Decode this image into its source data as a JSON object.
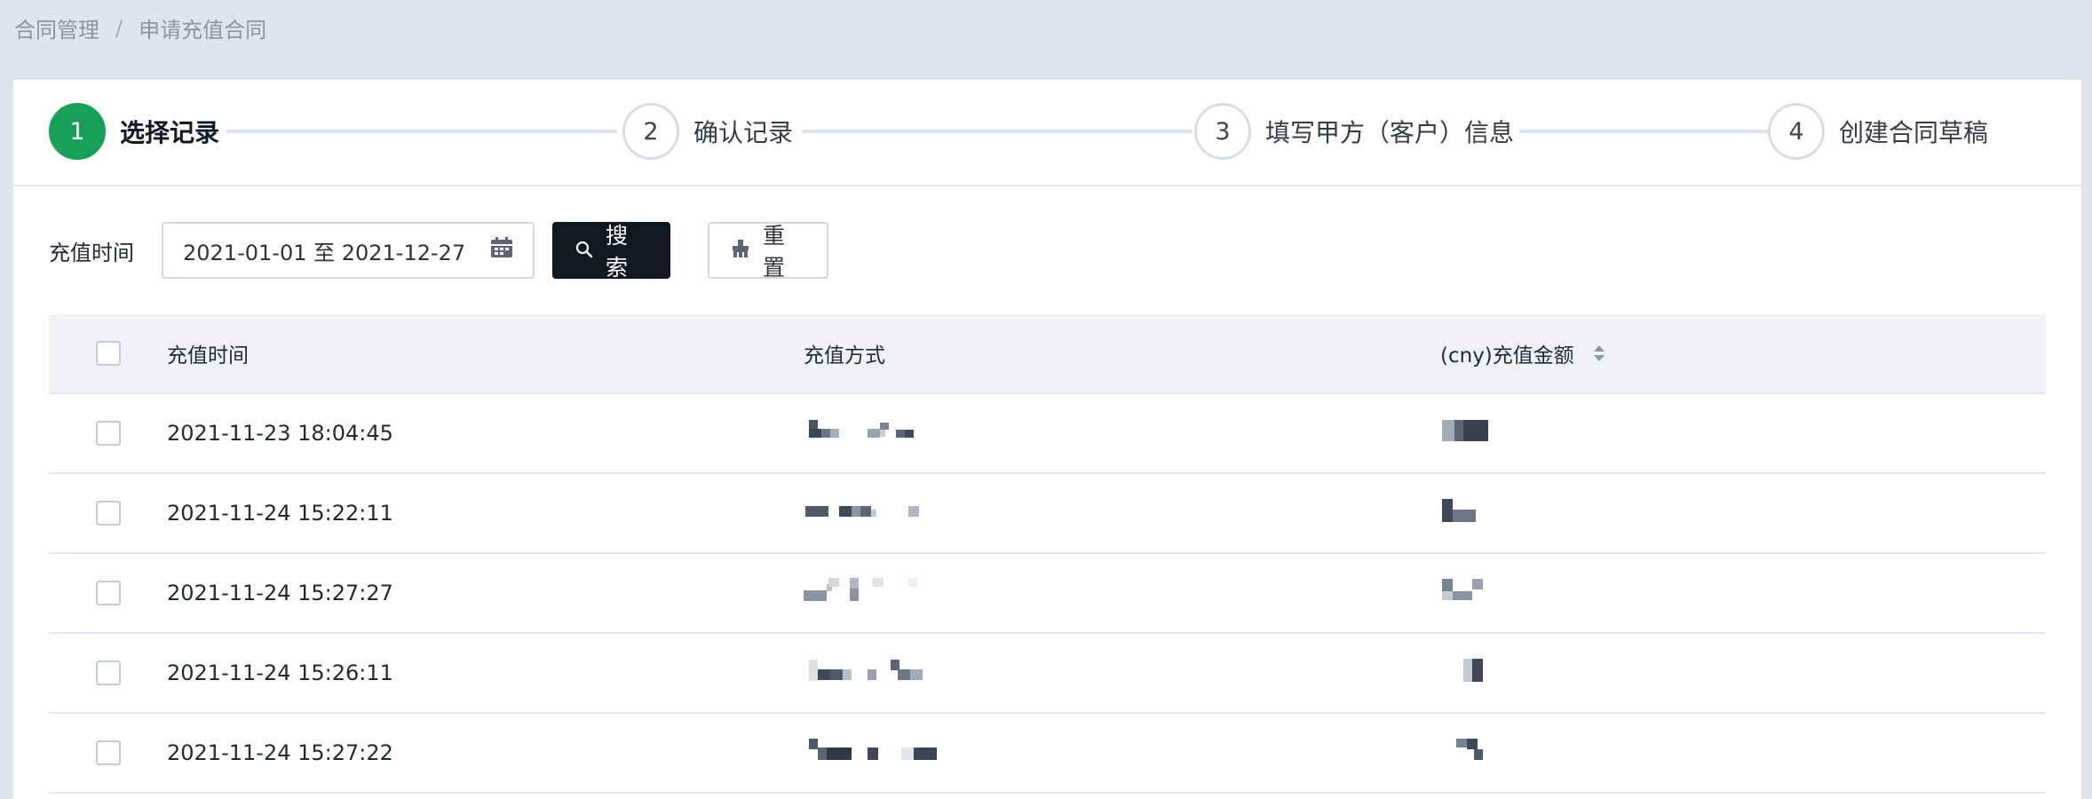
{
  "breadcrumb": {
    "root": "合同管理",
    "separator": "/",
    "current": "申请充值合同"
  },
  "steps": [
    {
      "number": "1",
      "label": "选择记录",
      "active": true
    },
    {
      "number": "2",
      "label": "确认记录",
      "active": false
    },
    {
      "number": "3",
      "label": "填写甲方（客户）信息",
      "active": false
    },
    {
      "number": "4",
      "label": "创建合同草稿",
      "active": false
    }
  ],
  "filter": {
    "label": "充值时间",
    "date_range": "2021-01-01 至 2021-12-27",
    "search_label": "搜索",
    "reset_label": "重置"
  },
  "table": {
    "columns": [
      "充值时间",
      "充值方式",
      "(cny)充值金额"
    ],
    "rows": [
      {
        "time": "2021-11-23 18:04:45",
        "method": "[pixelated]",
        "amount": "[pixelated]"
      },
      {
        "time": "2021-11-24 15:22:11",
        "method": "[pixelated]",
        "amount": "[pixelated]"
      },
      {
        "time": "2021-11-24 15:27:27",
        "method": "[pixelated]",
        "amount": "[pixelated]"
      },
      {
        "time": "2021-11-24 15:26:11",
        "method": "[pixelated]",
        "amount": "[pixelated]"
      },
      {
        "time": "2021-11-24 15:27:22",
        "method": "[pixelated]",
        "amount": "[pixelated]"
      }
    ]
  },
  "icons": {
    "calendar": "calendar-icon",
    "search": "search-icon",
    "reset": "broom-icon",
    "sort": "sort-icon"
  },
  "colors": {
    "accent": "#18a058",
    "primary_button": "#111820",
    "background": "#dfe5ec"
  }
}
